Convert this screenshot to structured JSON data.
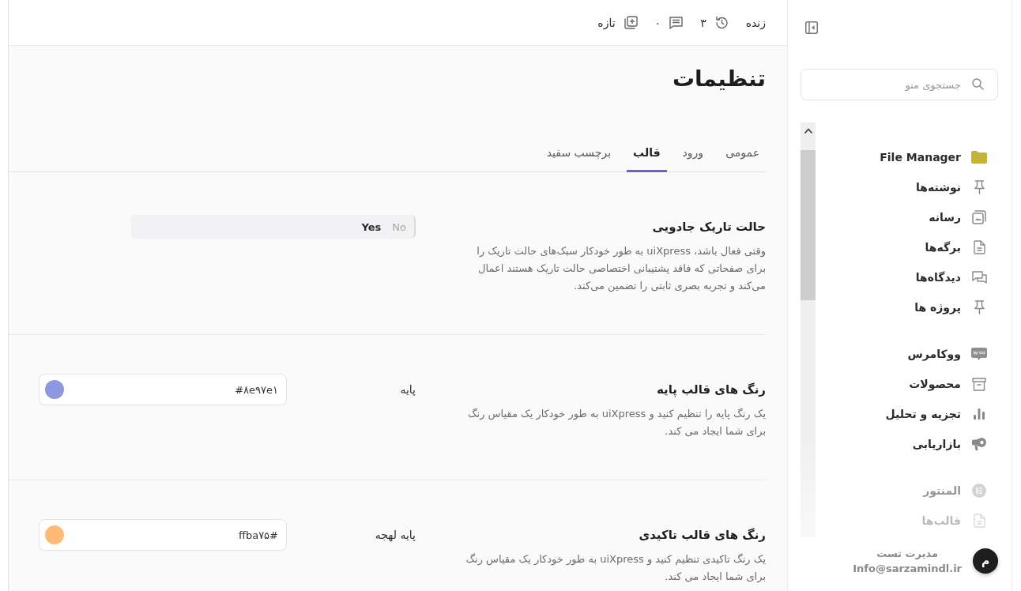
{
  "sidebar": {
    "search": {
      "placeholder": "جستجوی منو"
    },
    "menu_groups": [
      {
        "items": [
          {
            "label": "File Manager"
          },
          {
            "label": "نوشته‌ها"
          },
          {
            "label": "رسانه"
          },
          {
            "label": "برگه‌ها"
          },
          {
            "label": "دیدگاه‌ها"
          },
          {
            "label": "پروژه ها"
          }
        ]
      },
      {
        "items": [
          {
            "label": "ووکامرس"
          },
          {
            "label": "محصولات"
          },
          {
            "label": "تجزیه و تحلیل"
          },
          {
            "label": "بازاریابی"
          }
        ]
      },
      {
        "items": [
          {
            "label": "المنتور"
          },
          {
            "label": "قالب‌ها"
          }
        ]
      }
    ],
    "user": {
      "avatar_initial": "م",
      "name": "مدیرت تست",
      "email": "Info@sarzamindl.ir"
    }
  },
  "top_bar": {
    "live": "زنده",
    "revisions": "۳",
    "comments": "۰",
    "new": "تازه"
  },
  "page": {
    "title": "تنظیمات",
    "tabs": [
      {
        "label": "عمومی",
        "selected": false
      },
      {
        "label": "ورود",
        "selected": false
      },
      {
        "label": "قالب",
        "selected": true
      },
      {
        "label": "برچسب سفید",
        "selected": false
      }
    ],
    "settings": [
      {
        "kind": "toggle",
        "title": "حالت تاریک جادویی",
        "description": "وقتی فعال باشد، uiXpress به طور خودکار سبک‌های حالت تاریک را برای صفحاتی که فاقد پشتیبانی اختصاصی حالت تاریک هستند اعمال می‌کند و تجربه بصری ثابتی را تضمین می‌کند.",
        "options": [
          {
            "label": "No",
            "selected": false
          },
          {
            "label": "Yes",
            "selected": true
          }
        ]
      },
      {
        "kind": "color",
        "title": "رنگ های قالب پایه",
        "description": "یک رنگ پایه را تنظیم کنید و uiXpress به طور خودکار یک مقیاس رنگ برای شما ایجاد می کند.",
        "label": "پایه",
        "value": "#۸e۹۷e۱",
        "color": "#8e97e1"
      },
      {
        "kind": "color",
        "title": "رنگ های قالب تاکیدی",
        "description": "یک رنگ تاکیدی تنظیم کنید و uiXpress به طور خودکار یک مقیاس رنگ برای شما ایجاد می کند.",
        "label": "پایه لهجه",
        "value": "ffba۷۵#",
        "color": "#ffba75"
      }
    ]
  }
}
